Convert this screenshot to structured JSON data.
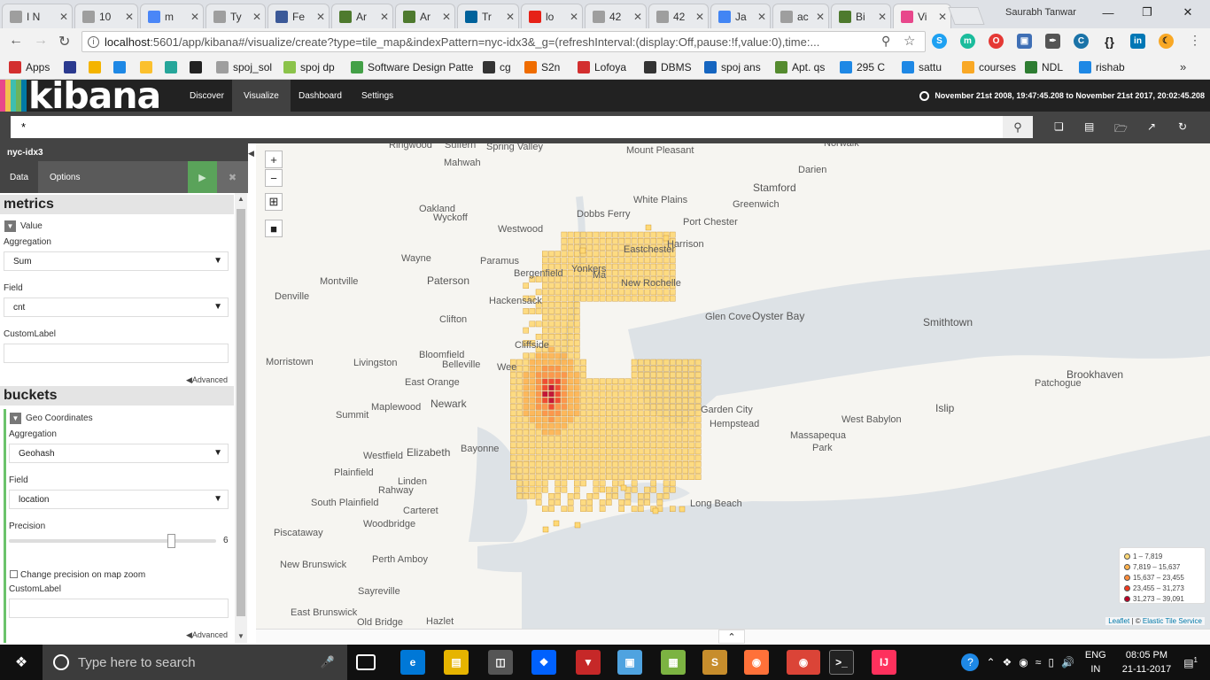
{
  "browser": {
    "tabs": [
      {
        "title": "I N",
        "color": "#9e9e9e"
      },
      {
        "title": "10",
        "color": "#9e9e9e"
      },
      {
        "title": "m",
        "color": "#4a86f7"
      },
      {
        "title": "Ty",
        "color": "#9e9e9e"
      },
      {
        "title": "Fe",
        "color": "#3b5998"
      },
      {
        "title": "Ar",
        "color": "#4e7a2e"
      },
      {
        "title": "Ar",
        "color": "#4e7a2e"
      },
      {
        "title": "Tr",
        "color": "#00629b"
      },
      {
        "title": "lo",
        "color": "#e62117"
      },
      {
        "title": "42",
        "color": "#9e9e9e"
      },
      {
        "title": "42",
        "color": "#9e9e9e"
      },
      {
        "title": "Ja",
        "color": "#4285f4"
      },
      {
        "title": "ac",
        "color": "#9e9e9e"
      },
      {
        "title": "Bi",
        "color": "#4e7a2e"
      },
      {
        "title": "Vi",
        "color": "#e8478b",
        "active": true
      }
    ],
    "user_name": "Saurabh Tanwar",
    "url_host": "localhost",
    "url_rest": ":5601/app/kibana#/visualize/create?type=tile_map&indexPattern=nyc-idx3&_g=(refreshInterval:(display:Off,pause:!f,value:0),time:...",
    "bookmarks": [
      {
        "label": "Apps",
        "icon": "apps-grid-icon",
        "color": "#d32f2f"
      },
      {
        "label": "",
        "icon": "h-icon",
        "color": "#2b3a8f"
      },
      {
        "label": "",
        "icon": "chart-icon",
        "color": "#f4b400"
      },
      {
        "label": "",
        "icon": "s-icon",
        "color": "#1e88e5"
      },
      {
        "label": "",
        "icon": "id-icon",
        "color": "#fbc02d"
      },
      {
        "label": "",
        "icon": "ib-icon",
        "color": "#26a69a"
      },
      {
        "label": "",
        "icon": "a2-icon",
        "color": "#222222"
      },
      {
        "label": "spoj_sol",
        "icon": "doc-icon",
        "color": "#9e9e9e"
      },
      {
        "label": "spoj dp",
        "icon": "leaf-icon",
        "color": "#8bc34a"
      },
      {
        "label": "Software Design Patte",
        "icon": "tree-icon",
        "color": "#43a047"
      },
      {
        "label": "cg",
        "icon": "g-icon",
        "color": "#333333"
      },
      {
        "label": "S2n",
        "icon": "fox-icon",
        "color": "#ef6c00"
      },
      {
        "label": "Lofoya",
        "icon": "lofoya-icon",
        "color": "#d32f2f"
      },
      {
        "label": "DBMS",
        "icon": "diamond-icon",
        "color": "#333333"
      },
      {
        "label": "spoj ans",
        "icon": "spoj-icon",
        "color": "#1565c0"
      },
      {
        "label": "Apt. qs",
        "icon": "apt-icon",
        "color": "#558b2f"
      },
      {
        "label": "295 C",
        "icon": "p-icon",
        "color": "#1e88e5"
      },
      {
        "label": "sattu",
        "icon": "s-icon",
        "color": "#1e88e5"
      },
      {
        "label": "courses",
        "icon": "circle-icon",
        "color": "#f9a825"
      },
      {
        "label": "NDL",
        "icon": "ndl-icon",
        "color": "#2e7d32"
      },
      {
        "label": "rishab",
        "icon": "s-icon",
        "color": "#1e88e5"
      }
    ]
  },
  "kibana": {
    "logo_text": "kibana",
    "nav": [
      "Discover",
      "Visualize",
      "Dashboard",
      "Settings"
    ],
    "active_nav": "Visualize",
    "timerange": "November 21st 2008, 19:47:45.208 to November 21st 2017, 20:02:45.208",
    "query": "*",
    "index_pattern": "nyc-idx3",
    "subtabs": [
      "Data",
      "Options"
    ],
    "metrics": {
      "title": "metrics",
      "item": "Value",
      "aggregation_label": "Aggregation",
      "aggregation": "Sum",
      "field_label": "Field",
      "field": "cnt",
      "custom_label": "CustomLabel",
      "advanced": "Advanced"
    },
    "buckets": {
      "title": "buckets",
      "item": "Geo Coordinates",
      "aggregation_label": "Aggregation",
      "aggregation": "Geohash",
      "field_label": "Field",
      "field": "location",
      "precision_label": "Precision",
      "precision": 6,
      "precision_fraction": 0.78,
      "change_precision": "Change precision on map zoom",
      "custom_label": "CustomLabel",
      "advanced": "Advanced"
    }
  },
  "map": {
    "zoom_in": "+",
    "zoom_out": "−",
    "places": [
      "Ringwood",
      "Suffern",
      "Spring Valley",
      "Norwalk",
      "Mount Pleasant",
      "Mahwah",
      "Darien",
      "Stamford",
      "Oakland",
      "Wyckoff",
      "Dobbs Ferry",
      "White Plains",
      "Greenwich",
      "Port Chester",
      "Westwood",
      "Harrison",
      "Wayne",
      "Paramus",
      "Bergenfield",
      "Eastchester",
      "Yonkers",
      "New Rochelle",
      "Montville",
      "Paterson",
      "Denville",
      "Hackensack",
      "Glen Cove",
      "Oyster Bay",
      "Smithtown",
      "Clifton",
      "Morristown",
      "Livingston",
      "Bloomfield",
      "Belleville",
      "Brookhaven",
      "Patchogue",
      "East Orange",
      "Maplewood",
      "Newark",
      "Garden City",
      "Hempstead",
      "Islip",
      "West Babylon",
      "Summit",
      "Massapequa",
      "Park",
      "Westfield",
      "Elizabeth",
      "Bayonne",
      "Plainfield",
      "Linden",
      "Rahway",
      "Long Beach",
      "South Plainfield",
      "Carteret",
      "Woodbridge",
      "Piscataway",
      "Perth Amboy",
      "New Brunswick",
      "Sayreville",
      "East Brunswick",
      "Old Bridge",
      "Hazlet",
      "Cliffside",
      "Wee",
      "Ma"
    ],
    "legend": [
      {
        "label": "1 – 7,819",
        "color": "#fed976"
      },
      {
        "label": "7,819 – 15,637",
        "color": "#feb24c"
      },
      {
        "label": "15,637 – 23,455",
        "color": "#fd8d3c"
      },
      {
        "label": "23,455 – 31,273",
        "color": "#f03b20"
      },
      {
        "label": "31,273 – 39,091",
        "color": "#bd0026"
      }
    ],
    "attribution_leaflet": "Leaflet",
    "attribution_sep": " | © ",
    "attribution_tiles": "Elastic Tile Service"
  },
  "taskbar": {
    "search_placeholder": "Type here to search",
    "lang1": "ENG",
    "lang2": "IN",
    "time": "08:05 PM",
    "date": "21-11-2017",
    "notifications": "1"
  }
}
